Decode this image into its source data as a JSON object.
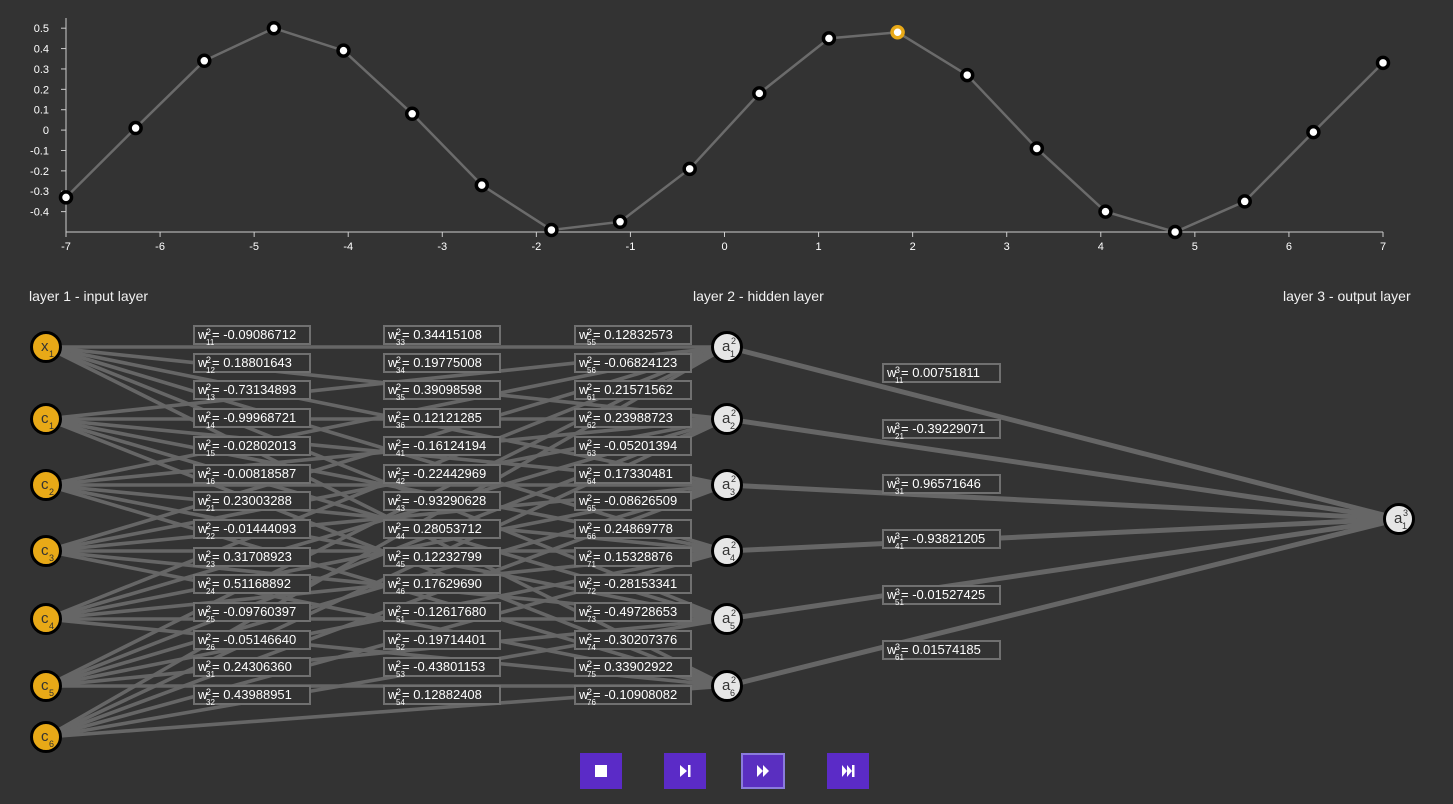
{
  "chart_data": {
    "type": "line",
    "xlim": [
      -7,
      7
    ],
    "ylim": [
      -0.5,
      0.55
    ],
    "x_ticks": [
      -7,
      -6,
      -5,
      -4,
      -3,
      -2,
      -1,
      0,
      1,
      2,
      3,
      4,
      5,
      6,
      7
    ],
    "y_ticks": [
      0.5,
      0.4,
      0.3,
      0.2,
      0.1,
      0,
      -0.1,
      -0.2,
      -0.3,
      -0.4
    ],
    "x": [
      -7,
      -6.26,
      -5.53,
      -4.79,
      -4.05,
      -3.32,
      -2.58,
      -1.84,
      -1.11,
      -0.37,
      0.37,
      1.11,
      1.84,
      2.58,
      3.32,
      4.05,
      4.79,
      5.53,
      6.26,
      7
    ],
    "y": [
      -0.33,
      0.01,
      0.34,
      0.5,
      0.39,
      0.08,
      -0.27,
      -0.49,
      -0.45,
      -0.19,
      0.18,
      0.45,
      0.48,
      0.27,
      -0.09,
      -0.4,
      -0.5,
      -0.35,
      -0.01,
      0.33
    ],
    "highlight_index": 12,
    "grid": false,
    "colors": {
      "line": "#6b6b6b",
      "point_fill": "#ffffff",
      "point_stroke": "#000000",
      "highlight": "#e8a917",
      "axis": "#cccccc"
    }
  },
  "layers": {
    "input": "layer 1 - input layer",
    "hidden": "layer 2 - hidden layer",
    "output": "layer 3 - output layer"
  },
  "nodes": {
    "input": [
      {
        "base": "x",
        "sub": "1"
      },
      {
        "base": "c",
        "sub": "1"
      },
      {
        "base": "c",
        "sub": "2"
      },
      {
        "base": "c",
        "sub": "3"
      },
      {
        "base": "c",
        "sub": "4"
      },
      {
        "base": "c",
        "sub": "5"
      },
      {
        "base": "c",
        "sub": "6"
      }
    ],
    "hidden": [
      {
        "base": "a",
        "sup": "2",
        "sub": "1"
      },
      {
        "base": "a",
        "sup": "2",
        "sub": "2"
      },
      {
        "base": "a",
        "sup": "2",
        "sub": "3"
      },
      {
        "base": "a",
        "sup": "2",
        "sub": "4"
      },
      {
        "base": "a",
        "sup": "2",
        "sub": "5"
      },
      {
        "base": "a",
        "sup": "2",
        "sub": "6"
      }
    ],
    "output": [
      {
        "base": "a",
        "sup": "3",
        "sub": "1"
      }
    ]
  },
  "weights2": [
    [
      {
        "sub": "11",
        "value": "-0.09086712"
      },
      {
        "sub": "12",
        "value": "0.18801643"
      },
      {
        "sub": "13",
        "value": "-0.73134893"
      },
      {
        "sub": "14",
        "value": "-0.99968721"
      },
      {
        "sub": "15",
        "value": "-0.02802013"
      },
      {
        "sub": "16",
        "value": "-0.00818587"
      },
      {
        "sub": "21",
        "value": "0.23003288"
      },
      {
        "sub": "22",
        "value": "-0.01444093"
      },
      {
        "sub": "23",
        "value": "0.31708923"
      },
      {
        "sub": "24",
        "value": "0.51168892"
      },
      {
        "sub": "25",
        "value": "-0.09760397"
      },
      {
        "sub": "26",
        "value": "-0.05146640"
      },
      {
        "sub": "31",
        "value": "0.24306360"
      },
      {
        "sub": "32",
        "value": "0.43988951"
      }
    ],
    [
      {
        "sub": "33",
        "value": "0.34415108"
      },
      {
        "sub": "34",
        "value": "0.19775008"
      },
      {
        "sub": "35",
        "value": "0.39098598"
      },
      {
        "sub": "36",
        "value": "0.12121285"
      },
      {
        "sub": "41",
        "value": "-0.16124194"
      },
      {
        "sub": "42",
        "value": "-0.22442969"
      },
      {
        "sub": "43",
        "value": "-0.93290628"
      },
      {
        "sub": "44",
        "value": "0.28053712"
      },
      {
        "sub": "45",
        "value": "0.12232799"
      },
      {
        "sub": "46",
        "value": "0.17629690"
      },
      {
        "sub": "51",
        "value": "-0.12617680"
      },
      {
        "sub": "52",
        "value": "-0.19714401"
      },
      {
        "sub": "53",
        "value": "-0.43801153"
      },
      {
        "sub": "54",
        "value": "0.12882408"
      }
    ],
    [
      {
        "sub": "55",
        "value": "0.12832573"
      },
      {
        "sub": "56",
        "value": "-0.06824123"
      },
      {
        "sub": "61",
        "value": "0.21571562"
      },
      {
        "sub": "62",
        "value": "0.23988723"
      },
      {
        "sub": "63",
        "value": "-0.05201394"
      },
      {
        "sub": "64",
        "value": "0.17330481"
      },
      {
        "sub": "65",
        "value": "-0.08626509"
      },
      {
        "sub": "66",
        "value": "0.24869778"
      },
      {
        "sub": "71",
        "value": "0.15328876"
      },
      {
        "sub": "72",
        "value": "-0.28153341"
      },
      {
        "sub": "73",
        "value": "-0.49728653"
      },
      {
        "sub": "74",
        "value": "-0.30207376"
      },
      {
        "sub": "75",
        "value": "0.33902922"
      },
      {
        "sub": "76",
        "value": "-0.10908082"
      }
    ]
  ],
  "weights3": [
    {
      "sub": "11",
      "value": "0.00751811"
    },
    {
      "sub": "21",
      "value": "-0.39229071"
    },
    {
      "sub": "31",
      "value": "0.96571646"
    },
    {
      "sub": "41",
      "value": "-0.93821205"
    },
    {
      "sub": "51",
      "value": "-0.01527425"
    },
    {
      "sub": "61",
      "value": "0.01574185"
    }
  ],
  "weight_symbol": "w",
  "weight_sup2": "2",
  "weight_sup3": "3",
  "weight_eq": "=",
  "controls": [
    {
      "id": "stop",
      "icon": "stop-icon",
      "active": false
    },
    {
      "id": "step",
      "icon": "step-forward-icon",
      "active": false
    },
    {
      "id": "play",
      "icon": "fast-forward-icon",
      "active": true
    },
    {
      "id": "end",
      "icon": "skip-to-end-icon",
      "active": false
    }
  ],
  "colors": {
    "background": "#333333",
    "edge": "#666666",
    "input_node": "#e8a917",
    "hidden_node": "#e6e6e6",
    "button": "#5b2bc7"
  }
}
